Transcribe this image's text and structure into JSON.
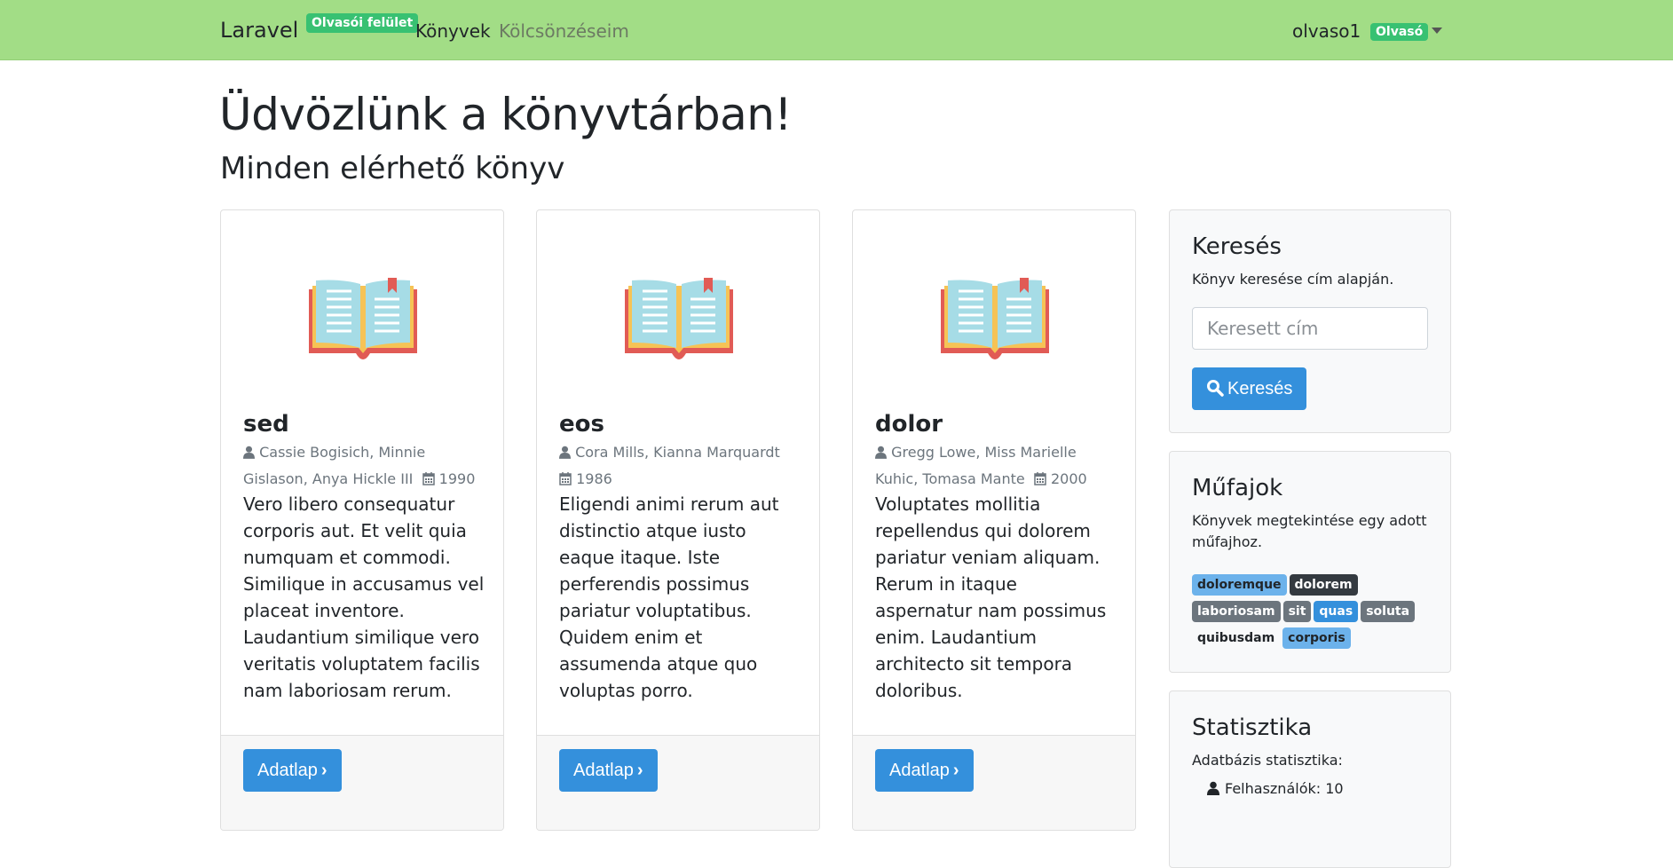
{
  "navbar": {
    "brand": "Laravel",
    "ui_badge": "Olvasói felület",
    "nav_books": "Könyvek",
    "nav_loans": "Kölcsönzéseim",
    "username": "olvaso1",
    "role_badge": "Olvasó"
  },
  "page": {
    "title": "Üdvözlünk a könyvtárban!",
    "subtitle": "Minden elérhető könyv"
  },
  "books": [
    {
      "title": "sed",
      "authors": "Cassie Bogisich, Minnie Gislason, Anya Hickle III",
      "year": "1990",
      "description": "Vero libero consequatur corporis aut. Et velit quia numquam et commodi. Similique in accusamus vel placeat inventore. Laudantium similique vero veritatis voluptatem facilis nam laboriosam rerum.",
      "button": "Adatlap"
    },
    {
      "title": "eos",
      "authors": "Cora Mills, Kianna Marquardt",
      "year": "1986",
      "description": "Eligendi animi rerum aut distinctio atque iusto eaque itaque. Iste perferendis possimus pariatur voluptatibus. Quidem enim et assumenda atque quo voluptas porro.",
      "button": "Adatlap"
    },
    {
      "title": "dolor",
      "authors": "Gregg Lowe, Miss Marielle Kuhic, Tomasa Mante",
      "year": "2000",
      "description": "Voluptates mollitia repellendus qui dolorem pariatur veniam aliquam. Rerum in itaque aspernatur nam possimus enim. Laudantium architecto sit tempora doloribus.",
      "button": "Adatlap"
    }
  ],
  "search": {
    "title": "Keresés",
    "subtitle": "Könyv keresése cím alapján.",
    "placeholder": "Keresett cím",
    "button": "Keresés"
  },
  "genres": {
    "title": "Műfajok",
    "subtitle": "Könyvek megtekintése egy adott műfajhoz.",
    "tags": [
      {
        "label": "doloremque",
        "style": "light"
      },
      {
        "label": "dolorem",
        "style": "dark"
      },
      {
        "label": "laboriosam",
        "style": "gray"
      },
      {
        "label": "sit",
        "style": "gray"
      },
      {
        "label": "quas",
        "style": "blue"
      },
      {
        "label": "soluta",
        "style": "gray"
      },
      {
        "label": "quibusdam",
        "style": "plain"
      },
      {
        "label": "corporis",
        "style": "light"
      }
    ]
  },
  "stats": {
    "title": "Statisztika",
    "subtitle": "Adatbázis statisztika:",
    "users": "Felhasználók: 10"
  },
  "colors": {
    "navbar": "#a2dd86",
    "success": "#38c172",
    "primary": "#3490dc"
  }
}
